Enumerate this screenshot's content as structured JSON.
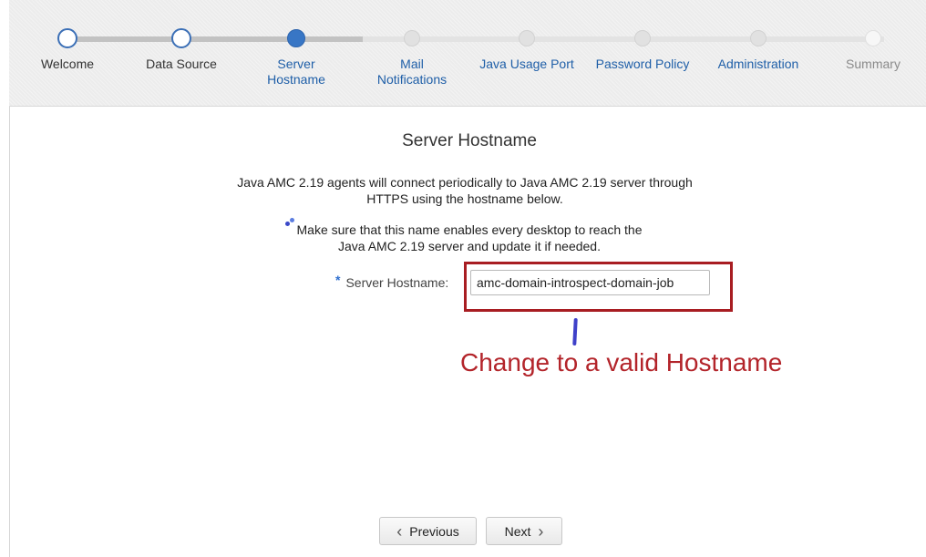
{
  "train": {
    "steps": [
      {
        "label": "Welcome",
        "state": "visited"
      },
      {
        "label": "Data Source",
        "state": "visited"
      },
      {
        "label": "Server\nHostname",
        "state": "current"
      },
      {
        "label": "Mail\nNotifications",
        "state": "unvisited"
      },
      {
        "label": "Java Usage Port",
        "state": "unvisited"
      },
      {
        "label": "Password Policy",
        "state": "unvisited"
      },
      {
        "label": "Administration",
        "state": "unvisited"
      },
      {
        "label": "Summary",
        "state": "disabled"
      }
    ]
  },
  "page": {
    "title": "Server Hostname",
    "intro": "Java AMC 2.19 agents will connect periodically to Java AMC 2.19 server through HTTPS using the hostname below.",
    "note": "Make sure that this name enables every desktop to reach the Java AMC 2.19 server and update it if needed.",
    "note_icon": "info-dots-icon"
  },
  "form": {
    "required_marker": "*",
    "hostname_label": "Server Hostname:",
    "hostname_value": "amc-domain-introspect-domain-job"
  },
  "annotation": {
    "text": "Change to a valid Hostname",
    "color": "#b3242a"
  },
  "nav": {
    "previous_label": "Previous",
    "next_label": "Next",
    "previous_icon": "chevron-left-icon",
    "next_icon": "chevron-right-icon"
  },
  "colors": {
    "accent": "#3876c5",
    "link": "#1f5fa8",
    "highlight": "#a81d22"
  }
}
